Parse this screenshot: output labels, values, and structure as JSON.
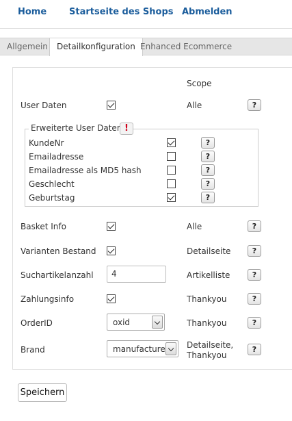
{
  "nav": {
    "home": "Home",
    "shop_start": "Startseite des Shops",
    "logout": "Abmelden"
  },
  "tabs": {
    "general": "Allgemein",
    "detail": "Detailkonfiguration",
    "ecommerce": "Enhanced Ecommerce"
  },
  "header": {
    "scope": "Scope"
  },
  "user_data": {
    "label": "User Daten",
    "checked": true,
    "scope": "Alle"
  },
  "extended": {
    "legend": "Erweiterte User Daten",
    "warn_icon": "!",
    "items": [
      {
        "label": "KundeNr",
        "checked": true
      },
      {
        "label": "Emailadresse",
        "checked": false
      },
      {
        "label": "Emailadresse als MD5 hash",
        "checked": false
      },
      {
        "label": "Geschlecht",
        "checked": false
      },
      {
        "label": "Geburtstag",
        "checked": true
      }
    ]
  },
  "basket": {
    "label": "Basket Info",
    "checked": true,
    "scope": "Alle"
  },
  "variants": {
    "label": "Varianten Bestand",
    "checked": true,
    "scope": "Detailseite"
  },
  "search": {
    "label": "Suchartikelanzahl",
    "value": "4",
    "scope": "Artikelliste"
  },
  "payment": {
    "label": "Zahlungsinfo",
    "checked": true,
    "scope": "Thankyou"
  },
  "orderid": {
    "label": "OrderID",
    "value": "oxid",
    "scope": "Thankyou"
  },
  "brand": {
    "label": "Brand",
    "value": "manufacturer",
    "scope_line1": "Detailseite,",
    "scope_line2": "Thankyou"
  },
  "help_icon": "?",
  "save_label": "Speichern"
}
